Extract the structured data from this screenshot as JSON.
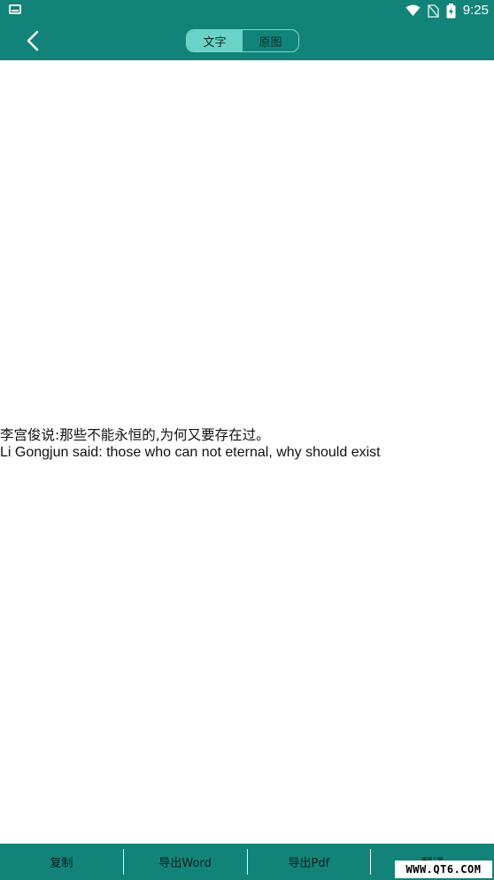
{
  "status_bar": {
    "time": "9:25",
    "icons": [
      "screen-icon",
      "wifi-icon",
      "no-sim-icon",
      "battery-charging-icon"
    ]
  },
  "app_bar": {
    "back_icon": "chevron-left-icon",
    "tabs": [
      {
        "label": "文字",
        "selected": true
      },
      {
        "label": "原图",
        "selected": false
      }
    ]
  },
  "content": {
    "lines": [
      "李宫俊说:那些不能永恒的,为何又要存在过。",
      "Li Gongjun said: those who can not eternal, why should exist"
    ]
  },
  "bottom_bar": {
    "buttons": [
      "复制",
      "导出Word",
      "导出Pdf",
      "翻译"
    ]
  },
  "watermark": "WWW.QT6.COM",
  "colors": {
    "primary": "#128378",
    "tab_active": "#6ad2c6",
    "background": "#ffffff"
  }
}
